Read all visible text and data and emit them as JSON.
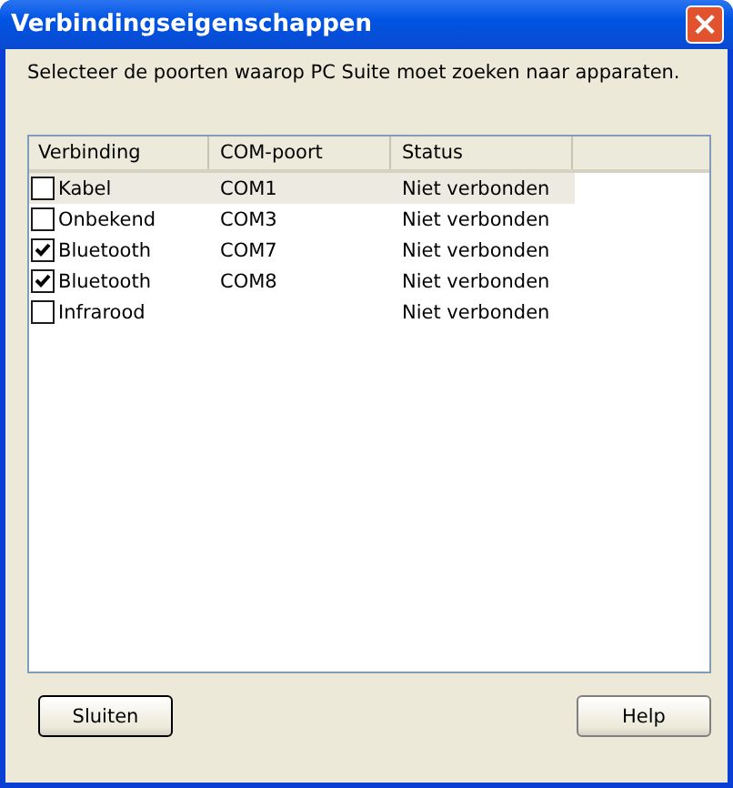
{
  "window": {
    "title": "Verbindingseigenschappen",
    "close": "×"
  },
  "instruction": "Selecteer de poorten waarop PC Suite moet zoeken naar apparaten.",
  "table": {
    "columns": [
      "Verbinding",
      "COM-poort",
      "Status"
    ],
    "rows": [
      {
        "cells": [
          "Kabel",
          "COM1",
          "Niet verbonden"
        ],
        "checked": false,
        "selected": true
      },
      {
        "cells": [
          "Onbekend",
          "COM3",
          "Niet verbonden"
        ],
        "checked": false,
        "selected": false
      },
      {
        "cells": [
          "Bluetooth",
          "COM7",
          "Niet verbonden"
        ],
        "checked": true,
        "selected": false
      },
      {
        "cells": [
          "Bluetooth",
          "COM8",
          "Niet verbonden"
        ],
        "checked": true,
        "selected": false
      },
      {
        "cells": [
          "Infrarood",
          "",
          "Niet verbonden"
        ],
        "checked": false,
        "selected": false
      }
    ]
  },
  "buttons": [
    {
      "label": "Sluiten",
      "kind": "default"
    },
    {
      "label": "Help",
      "kind": "normal"
    }
  ]
}
